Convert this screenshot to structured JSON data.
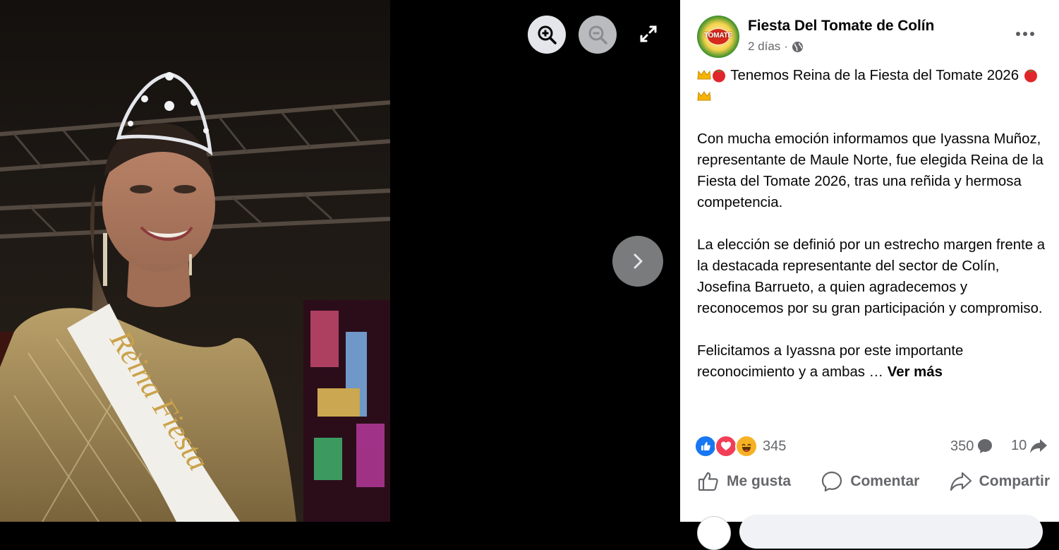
{
  "viewer": {
    "zoom_in_icon": "zoom-in-icon",
    "zoom_out_icon": "zoom-out-icon",
    "fullscreen_icon": "fullscreen-icon",
    "next_icon": "chevron-right-icon",
    "photo_sash_text": "Reina Fiesta",
    "colors": {
      "background": "#000000",
      "zoom_in_bg": "#e4e6eb",
      "zoom_out_bg": "#b9bbbe",
      "next_bg": "#7a7b7d"
    }
  },
  "post": {
    "page_name": "Fiesta Del Tomate de Colín",
    "avatar_logo_text": "TOMATE",
    "time": "2 días",
    "audience_icon": "globe-icon",
    "more_icon": "more-horizontal-icon",
    "paragraphs": [
      "Tenemos Reina de la Fiesta del Tomate 2026",
      "Con mucha emoción informamos que Iyassna Muñoz, representante de Maule Norte, fue elegida Reina de la Fiesta del Tomate 2026, tras una reñida y hermosa competencia.",
      "La elección se definió por un estrecho margen frente a la destacada representante del sector de Colín, Josefina Barrueto, a quien agradecemos y reconocemos por su gran participación y compromiso.",
      "Felicitamos a Iyassna por este importante reconocimiento y a ambas …"
    ],
    "see_more": "Ver más",
    "reaction_count": "345",
    "comment_count": "350",
    "share_count": "10",
    "actions": {
      "like": "Me gusta",
      "comment": "Comentar",
      "share": "Compartir"
    },
    "colors": {
      "like": "#1877f2",
      "love": "#f33e58",
      "haha": "#f7b125",
      "secondary_text": "#65676b"
    }
  }
}
